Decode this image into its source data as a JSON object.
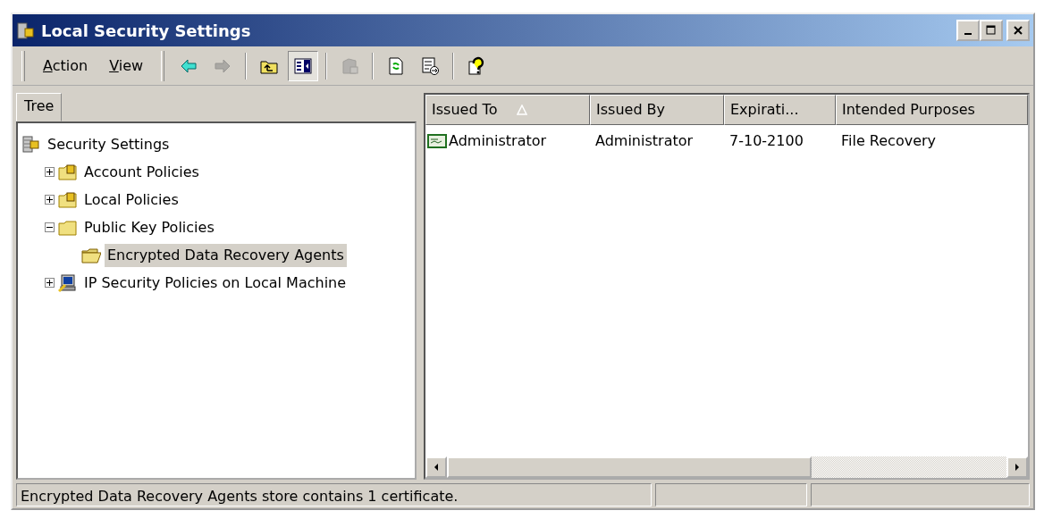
{
  "window": {
    "title": "Local Security Settings"
  },
  "menu": [
    {
      "label": "Action"
    },
    {
      "label": "View"
    }
  ],
  "toolbar": [
    {
      "kind": "back",
      "disabled": false,
      "pressed": false
    },
    {
      "kind": "forward",
      "disabled": true,
      "pressed": false
    },
    {
      "kind": "sep"
    },
    {
      "kind": "up",
      "disabled": false,
      "pressed": false
    },
    {
      "kind": "tree",
      "disabled": false,
      "pressed": true
    },
    {
      "kind": "sep"
    },
    {
      "kind": "delete",
      "disabled": true,
      "pressed": false
    },
    {
      "kind": "sep"
    },
    {
      "kind": "refresh",
      "disabled": false,
      "pressed": false
    },
    {
      "kind": "export",
      "disabled": false,
      "pressed": false
    },
    {
      "kind": "sep"
    },
    {
      "kind": "help",
      "disabled": false,
      "pressed": false
    }
  ],
  "tabs": [
    {
      "label": "Tree",
      "selected": true
    }
  ],
  "tree": [
    {
      "label": "Security Settings",
      "kind": "server",
      "selected": false,
      "children": [
        {
          "label": "Account Policies",
          "kind": "lockfolder",
          "selected": false,
          "expanded": false
        },
        {
          "label": "Local Policies",
          "kind": "lockfolder",
          "selected": false,
          "expanded": false
        },
        {
          "label": "Public Key Policies",
          "kind": "folder",
          "selected": false,
          "expanded": true,
          "children": [
            {
              "label": "Encrypted Data Recovery Agents",
              "kind": "openfolder",
              "selected": true
            }
          ]
        },
        {
          "label": "IP Security Policies on Local Machine",
          "kind": "computer",
          "selected": false,
          "expanded": false
        }
      ]
    }
  ],
  "table": {
    "columns": [
      {
        "label": "Issued To",
        "sorted": true
      },
      {
        "label": "Issued By",
        "sorted": false
      },
      {
        "label": "Expirati...",
        "sorted": false
      },
      {
        "label": "Intended Purposes",
        "sorted": false
      }
    ],
    "rows": [
      [
        "Administrator",
        "Administrator",
        "7-10-2100",
        "File Recovery"
      ]
    ]
  },
  "status_bar": [
    "Encrypted Data Recovery Agents store contains 1 certificate."
  ]
}
